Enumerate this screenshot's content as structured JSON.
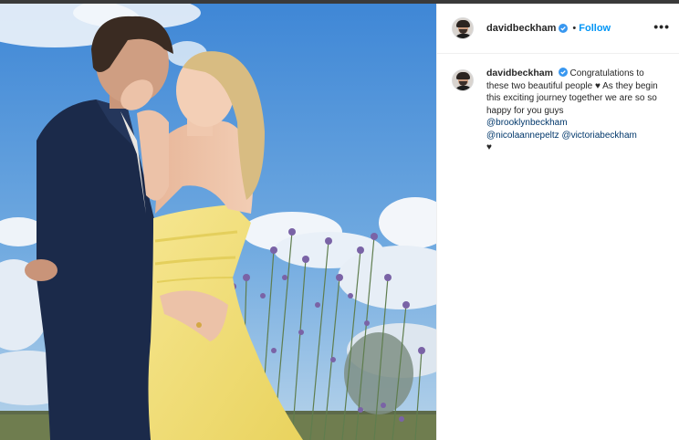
{
  "post": {
    "author": "davidbeckham",
    "follow_label": "Follow",
    "separator": "•",
    "more_icon": "more-options-icon",
    "caption": {
      "author": "davidbeckham",
      "text": "Congratulations to these two beautiful people ♥ As they begin this exciting journey together we are so so happy for you guys",
      "mentions": [
        "@brooklynbeckham",
        "@nicolaannepeltz",
        "@victoriabeckham"
      ],
      "trailing": "♥"
    }
  },
  "colors": {
    "follow": "#0095f6",
    "verified": "#3897f0",
    "mention": "#00376b",
    "dress": "#f3e27a",
    "suit": "#1b2a4a"
  }
}
